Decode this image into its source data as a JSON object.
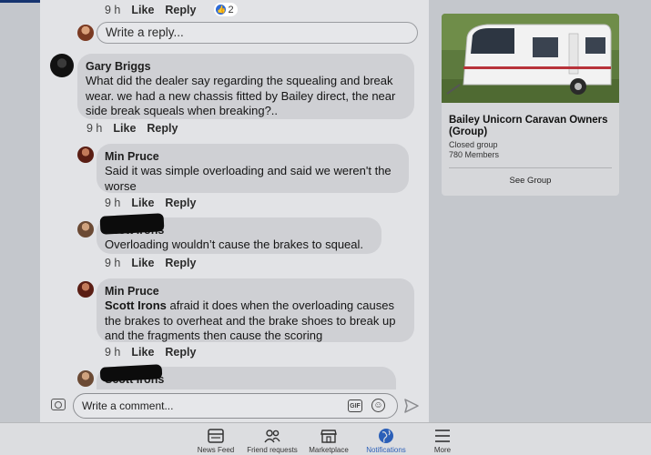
{
  "thread": {
    "prev_meta": {
      "time": "9 h",
      "like": "Like",
      "reply": "Reply",
      "reaction_count": "2"
    },
    "reply_placeholder": "Write a reply...",
    "comments": [
      {
        "author": "Gary Briggs",
        "text": "What did the dealer say regarding the squealing and break wear. we had a new chassis fitted by Bailey direct, the near side break squeals when breaking?..",
        "time": "9 h",
        "like": "Like",
        "reply": "Reply"
      },
      {
        "author": "Min Pruce",
        "text": "Said it was simple overloading and said we weren't the worse",
        "time": "9 h",
        "like": "Like",
        "reply": "Reply"
      },
      {
        "author": "Scott Irons",
        "text": "Overloading wouldn’t cause the brakes to squeal.",
        "time": "9 h",
        "like": "Like",
        "reply": "Reply"
      },
      {
        "author": "Min Pruce",
        "mention": "Scott Irons",
        "text": " afraid it does when the overloading causes the brakes to overheat and the brake shoes to break up and the fragments then cause the scoring",
        "time": "9 h",
        "like": "Like",
        "reply": "Reply"
      },
      {
        "author": "Scott Irons"
      }
    ]
  },
  "composer": {
    "placeholder": "Write a comment...",
    "gif_label": "GIF"
  },
  "group": {
    "title": "Bailey Unicorn  Caravan Owners (Group)",
    "privacy": "Closed group",
    "members": "780 Members",
    "see_group": "See Group"
  },
  "tabbar": {
    "items": [
      {
        "label": "News Feed",
        "icon": "news-feed-icon"
      },
      {
        "label": "Friend requests",
        "icon": "friends-icon"
      },
      {
        "label": "Marketplace",
        "icon": "marketplace-icon"
      },
      {
        "label": "Notifications",
        "icon": "globe-icon",
        "active": true
      },
      {
        "label": "More",
        "icon": "menu-icon"
      }
    ]
  },
  "colors": {
    "accent": "#2b5fb8",
    "topline": "#16346f"
  }
}
